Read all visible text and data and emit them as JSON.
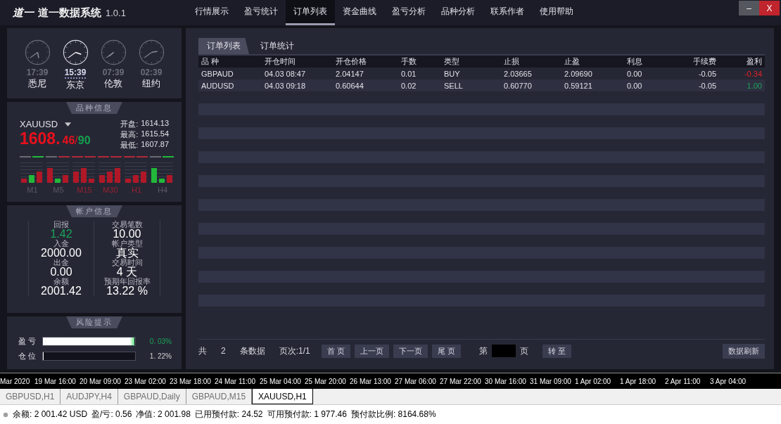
{
  "app": {
    "logo": "道一",
    "title": "道一数据系统",
    "version": "1.0.1"
  },
  "nav": [
    {
      "label": "行情展示",
      "selected": false
    },
    {
      "label": "盈亏统计",
      "selected": false
    },
    {
      "label": "订单列表",
      "selected": true
    },
    {
      "label": "资金曲线",
      "selected": false
    },
    {
      "label": "盈亏分析",
      "selected": false
    },
    {
      "label": "品种分析",
      "selected": false
    },
    {
      "label": "联系作者",
      "selected": false
    },
    {
      "label": "使用帮助",
      "selected": false
    }
  ],
  "window_buttons": [
    {
      "kind": "minimize",
      "label": "–"
    },
    {
      "kind": "close",
      "label": "X"
    }
  ],
  "clocks": [
    {
      "time": "17:39",
      "city": "悉尼",
      "selected": false
    },
    {
      "time": "15:39",
      "city": "东京",
      "selected": true
    },
    {
      "time": "07:39",
      "city": "伦敦",
      "selected": false
    },
    {
      "time": "02:39",
      "city": "纽约",
      "selected": false
    }
  ],
  "symbol_info": {
    "heading": "品种信息",
    "symbol": "XAUUSD",
    "price_main": "1608.",
    "price_bid": "46",
    "separator": "/",
    "price_ask": "90",
    "stats": [
      {
        "label": "开盘:",
        "value": "1614.13"
      },
      {
        "label": "最高:",
        "value": "1615.54"
      },
      {
        "label": "最低:",
        "value": "1607.87"
      }
    ],
    "timeframes": [
      {
        "label": "M1",
        "color": "#5a5a66"
      },
      {
        "label": "M5",
        "color": "#5a5a66"
      },
      {
        "label": "M15",
        "color": "#9a2030"
      },
      {
        "label": "M30",
        "color": "#9a2030"
      },
      {
        "label": "H1",
        "color": "#9a2030"
      },
      {
        "label": "H4",
        "color": "#5a5a66"
      }
    ]
  },
  "account_info": {
    "heading": "帐户信息",
    "items": [
      {
        "label": "回报",
        "value": "1.42",
        "color": "#1aa35a"
      },
      {
        "label": "交易笔数",
        "value": "10.00",
        "color": "#ffffff"
      },
      {
        "label": "入金",
        "value": "2000.00",
        "color": "#ffffff"
      },
      {
        "label": "帐户类型",
        "value": "真实",
        "color": "#ffffff"
      },
      {
        "label": "出金",
        "value": "0.00",
        "color": "#ffffff"
      },
      {
        "label": "交易时间",
        "value": "4 天",
        "color": "#ffffff"
      },
      {
        "label": "余额",
        "value": "2001.42",
        "color": "#ffffff"
      },
      {
        "label": "预期年回报率",
        "value": "13.22 %",
        "color": "#ffffff"
      }
    ]
  },
  "risk": {
    "heading": "风险提示",
    "bars": [
      {
        "label": "盈 亏",
        "level": 0.99,
        "reading": "0. 03%",
        "color": "#1aa35a"
      },
      {
        "label": "仓 位",
        "level": 0.005,
        "reading": "1. 22%",
        "color": "#d0d0d0"
      }
    ]
  },
  "sub_tabs": [
    {
      "label": "订单列表",
      "selected": true
    },
    {
      "label": "订单统计",
      "selected": false
    }
  ],
  "table": {
    "columns": [
      "品 种",
      "开仓时间",
      "开仓价格",
      "手数",
      "类型",
      "止损",
      "止盈",
      "利息",
      "手续费",
      "盈利"
    ],
    "rows": [
      {
        "cells": [
          "GBPAUD",
          "04.03 08:47",
          "2.04147",
          "0.01",
          "BUY",
          "2.03665",
          "2.09690",
          "0.00",
          "-0.05",
          "-0.34"
        ],
        "color": "#e0202a"
      },
      {
        "cells": [
          "AUDUSD",
          "04.03 09:18",
          "0.60644",
          "0.02",
          "SELL",
          "0.60770",
          "0.59121",
          "0.00",
          "-0.05",
          "1.00"
        ],
        "color": "#1aa35a"
      }
    ]
  },
  "pager": {
    "total_label": "共",
    "total": "2",
    "unit": "条数据",
    "page_info": "页次:1/1",
    "buttons": [
      "首 页",
      "上一页",
      "下一页",
      "尾 页"
    ],
    "goto_prefix": "第",
    "goto_suffix": "页",
    "goto_button": "转 至",
    "refresh": "数据刷新"
  },
  "timeline": [
    "Mar 2020",
    "19 Mar 16:00",
    "20 Mar 09:00",
    "23 Mar 02:00",
    "23 Mar 18:00",
    "24 Mar 11:00",
    "25 Mar 04:00",
    "25 Mar 20:00",
    "26 Mar 13:00",
    "27 Mar 06:00",
    "27 Mar 22:00",
    "30 Mar 16:00",
    "31 Mar 09:00",
    "1 Apr 02:00",
    "1 Apr 18:00",
    "2 Apr 11:00",
    "3 Apr 04:00"
  ],
  "chart_tabs": [
    {
      "label": "GBPUSD,H1",
      "selected": false
    },
    {
      "label": "AUDJPY,H4",
      "selected": false
    },
    {
      "label": "GBPAUD,Daily",
      "selected": false
    },
    {
      "label": "GBPAUD,M15",
      "selected": false
    },
    {
      "label": "XAUUSD,H1",
      "selected": true
    }
  ],
  "status": [
    "余额: 2 001.42 USD",
    "盈/亏: 0.56",
    "净值: 2 001.98",
    "已用预付款: 24.52",
    "可用预付款: 1 977.46",
    "预付款比例: 8164.68%"
  ]
}
